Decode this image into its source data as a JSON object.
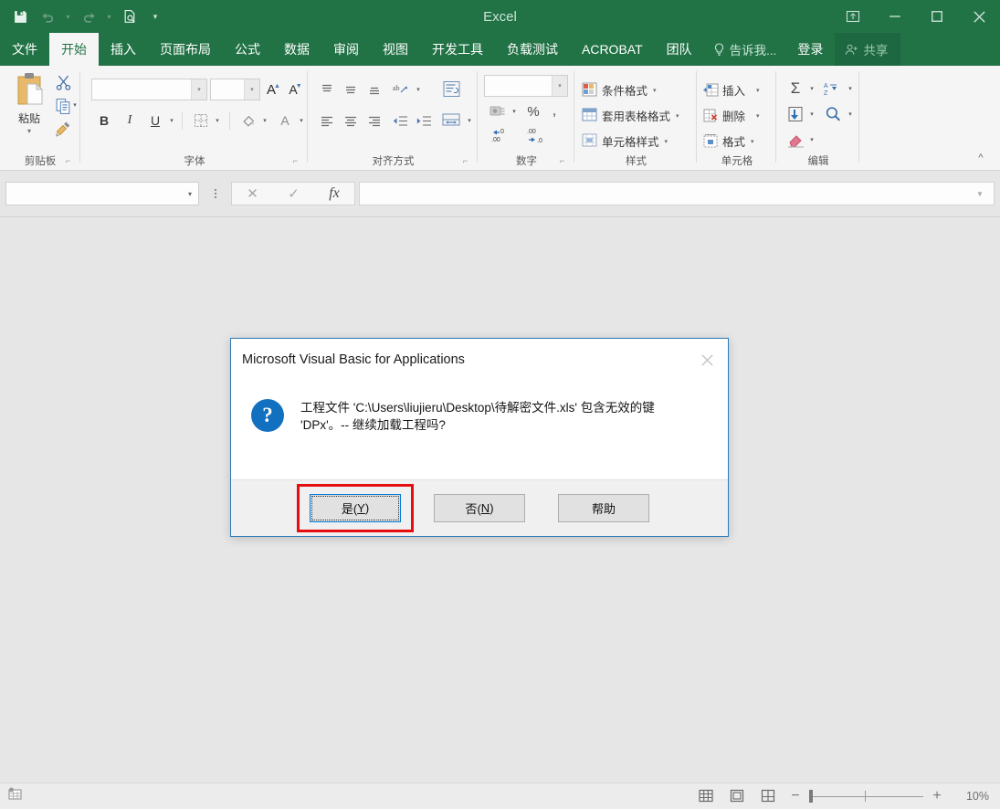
{
  "titlebar": {
    "app_title": "Excel",
    "qat": [
      {
        "name": "save-icon",
        "label": "保存"
      },
      {
        "name": "undo-icon",
        "label": "撤消"
      },
      {
        "name": "redo-icon",
        "label": "恢复"
      },
      {
        "name": "print-preview-icon",
        "label": "打印预览和打印"
      },
      {
        "name": "customize-qat-icon",
        "label": "自定义快速访问工具栏"
      }
    ],
    "window_controls": [
      {
        "name": "ribbon-display-options-icon",
        "label": "功能区显示选项"
      },
      {
        "name": "minimize-icon",
        "label": "最小化"
      },
      {
        "name": "maximize-icon",
        "label": "最大化"
      },
      {
        "name": "close-icon",
        "label": "关闭"
      }
    ]
  },
  "tabs": [
    {
      "label": "文件",
      "active": false
    },
    {
      "label": "开始",
      "active": true
    },
    {
      "label": "插入",
      "active": false
    },
    {
      "label": "页面布局",
      "active": false
    },
    {
      "label": "公式",
      "active": false
    },
    {
      "label": "数据",
      "active": false
    },
    {
      "label": "审阅",
      "active": false
    },
    {
      "label": "视图",
      "active": false
    },
    {
      "label": "开发工具",
      "active": false
    },
    {
      "label": "负载测试",
      "active": false
    },
    {
      "label": "ACROBAT",
      "active": false
    },
    {
      "label": "团队",
      "active": false
    }
  ],
  "tabbar_right": {
    "tell_me": "告诉我...",
    "sign_in": "登录",
    "share": "共享"
  },
  "ribbon": {
    "groups": [
      {
        "label": "剪贴板"
      },
      {
        "label": "字体"
      },
      {
        "label": "对齐方式"
      },
      {
        "label": "数字"
      },
      {
        "label": "样式"
      },
      {
        "label": "单元格"
      },
      {
        "label": "编辑"
      }
    ],
    "clipboard": {
      "paste_label": "粘贴",
      "cut_icon": "scissors-icon",
      "copy_icon": "copy-icon",
      "format_painter_icon": "format-painter-icon"
    },
    "font": {
      "font_name_value": "",
      "font_size_value": "",
      "grow_font": "A",
      "shrink_font": "A",
      "bold": "B",
      "italic": "I",
      "underline": "U"
    },
    "styles": [
      {
        "label": "条件格式",
        "icon": "conditional-formatting-icon"
      },
      {
        "label": "套用表格格式",
        "icon": "format-as-table-icon"
      },
      {
        "label": "单元格样式",
        "icon": "cell-styles-icon"
      }
    ],
    "cells": [
      {
        "label": "插入",
        "icon": "insert-cells-icon"
      },
      {
        "label": "删除",
        "icon": "delete-cells-icon"
      },
      {
        "label": "格式",
        "icon": "format-cells-icon"
      }
    ],
    "editing": [
      {
        "label": "",
        "icon": "autosum-icon",
        "glyph": "Σ"
      },
      {
        "label": "",
        "icon": "sort-filter-icon",
        "glyph": "A\nZ"
      },
      {
        "label": "",
        "icon": "fill-icon",
        "glyph": "↓"
      },
      {
        "label": "",
        "icon": "find-select-icon",
        "glyph": "⌕"
      },
      {
        "label": "",
        "icon": "clear-icon",
        "glyph": "◆"
      }
    ],
    "collapse_chevron": "^"
  },
  "formula_bar": {
    "name_box_value": "",
    "name_box_placeholder": "",
    "cancel_icon": "cancel-icon",
    "enter_icon": "enter-icon",
    "fx_label": "fx",
    "input_value": "",
    "expand_icon": "expand-formula-bar-icon"
  },
  "statusbar": {
    "macro_record_icon": "record-macro-icon",
    "views": [
      {
        "name": "normal-view-button",
        "icon": "grid-icon"
      },
      {
        "name": "page-layout-view-button",
        "icon": "page-icon"
      },
      {
        "name": "page-break-preview-button",
        "icon": "pagebreak-icon"
      }
    ],
    "zoom_out": "−",
    "zoom_in": "+",
    "zoom_value": "10%"
  },
  "dialog": {
    "title": "Microsoft Visual Basic for Applications",
    "close_icon": "close-icon",
    "icon": "question-icon",
    "icon_glyph": "?",
    "message": "工程文件 'C:\\Users\\liujieru\\Desktop\\待解密文件.xls' 包含无效的键 'DPx'。-- 继续加载工程吗?",
    "buttons": [
      {
        "label_prefix": "是(",
        "accel": "Y",
        "label_suffix": ")",
        "name": "yes-button",
        "focused": true,
        "highlighted": true
      },
      {
        "label_prefix": "否(",
        "accel": "N",
        "label_suffix": ")",
        "name": "no-button",
        "focused": false,
        "highlighted": false
      },
      {
        "label_prefix": "帮助",
        "accel": "",
        "label_suffix": "",
        "name": "help-button",
        "focused": false,
        "highlighted": false
      }
    ],
    "highlight_color": "#e50d0d"
  }
}
